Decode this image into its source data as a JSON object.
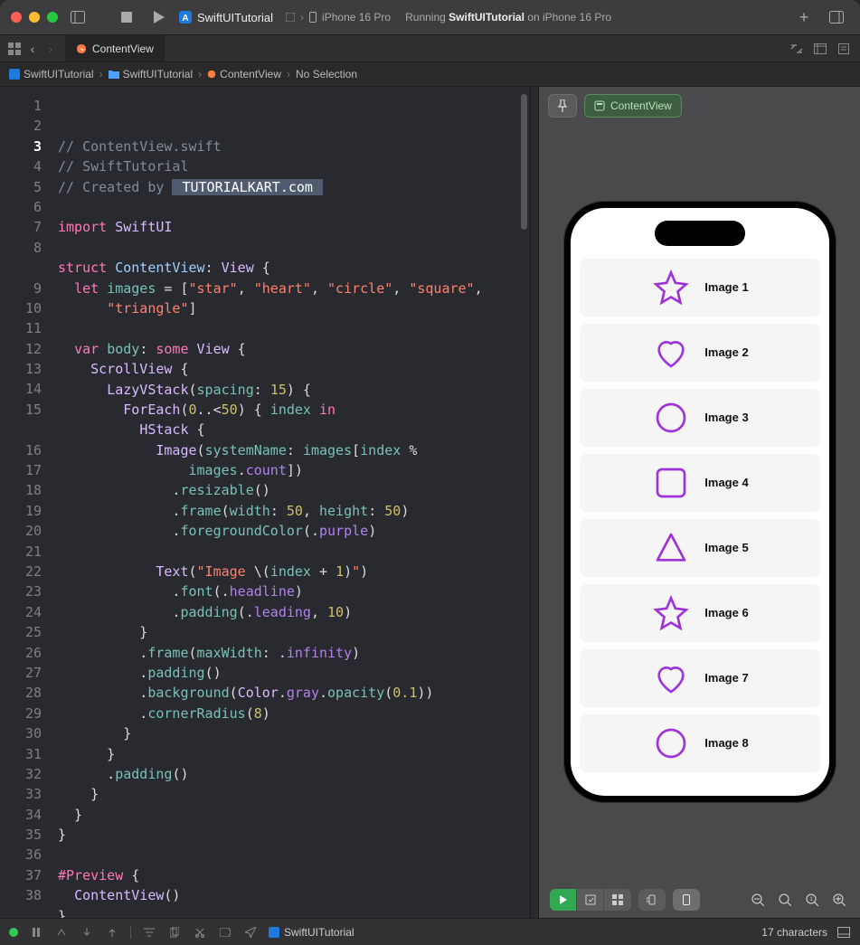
{
  "window": {
    "project_name": "SwiftUITutorial",
    "device": "iPhone 16 Pro",
    "status_prefix": "Running ",
    "status_bold": "SwiftUITutorial",
    "status_suffix": " on iPhone 16 Pro"
  },
  "tab": {
    "name": "ContentView"
  },
  "breadcrumb": {
    "items": [
      "SwiftUITutorial",
      "SwiftUITutorial",
      "ContentView",
      "No Selection"
    ]
  },
  "code": {
    "lines": [
      {
        "n": 1,
        "seg": [
          [
            "cm",
            "// ContentView.swift"
          ]
        ]
      },
      {
        "n": 2,
        "seg": [
          [
            "cm",
            "// SwiftTutorial"
          ]
        ]
      },
      {
        "n": 3,
        "seg": [
          [
            "cm",
            "// Created by "
          ],
          [
            "hlsel",
            " TUTORIALKART.com "
          ]
        ],
        "current": true
      },
      {
        "n": 4,
        "seg": []
      },
      {
        "n": 5,
        "seg": [
          [
            "kw",
            "import"
          ],
          [
            "pn",
            " "
          ],
          [
            "ty",
            "SwiftUI"
          ]
        ]
      },
      {
        "n": 6,
        "seg": []
      },
      {
        "n": 7,
        "seg": [
          [
            "kw",
            "struct"
          ],
          [
            "pn",
            " "
          ],
          [
            "id2",
            "ContentView"
          ],
          [
            "pn",
            ": "
          ],
          [
            "ty",
            "View"
          ],
          [
            "pn",
            " {"
          ]
        ]
      },
      {
        "n": 8,
        "seg": [
          [
            "pn",
            "  "
          ],
          [
            "kw",
            "let"
          ],
          [
            "pn",
            " "
          ],
          [
            "id",
            "images"
          ],
          [
            "pn",
            " = ["
          ],
          [
            "st",
            "\"star\""
          ],
          [
            "pn",
            ", "
          ],
          [
            "st",
            "\"heart\""
          ],
          [
            "pn",
            ", "
          ],
          [
            "st",
            "\"circle\""
          ],
          [
            "pn",
            ", "
          ],
          [
            "st",
            "\"square\""
          ],
          [
            "pn",
            ","
          ]
        ]
      },
      {
        "n": 0,
        "cont": true,
        "seg": [
          [
            "pn",
            "      "
          ],
          [
            "st",
            "\"triangle\""
          ],
          [
            "pn",
            "]"
          ]
        ]
      },
      {
        "n": 9,
        "seg": []
      },
      {
        "n": 10,
        "seg": [
          [
            "pn",
            "  "
          ],
          [
            "kw",
            "var"
          ],
          [
            "pn",
            " "
          ],
          [
            "id",
            "body"
          ],
          [
            "pn",
            ": "
          ],
          [
            "kw",
            "some"
          ],
          [
            "pn",
            " "
          ],
          [
            "ty",
            "View"
          ],
          [
            "pn",
            " {"
          ]
        ]
      },
      {
        "n": 11,
        "seg": [
          [
            "pn",
            "    "
          ],
          [
            "ty",
            "ScrollView"
          ],
          [
            "pn",
            " {"
          ]
        ]
      },
      {
        "n": 12,
        "seg": [
          [
            "pn",
            "      "
          ],
          [
            "ty",
            "LazyVStack"
          ],
          [
            "pn",
            "("
          ],
          [
            "fn",
            "spacing"
          ],
          [
            "pn",
            ": "
          ],
          [
            "nm",
            "15"
          ],
          [
            "pn",
            ") {"
          ]
        ]
      },
      {
        "n": 13,
        "seg": [
          [
            "pn",
            "        "
          ],
          [
            "ty",
            "ForEach"
          ],
          [
            "pn",
            "("
          ],
          [
            "nm",
            "0"
          ],
          [
            "pn",
            ".."
          ],
          [
            "pn",
            "<"
          ],
          [
            "nm",
            "50"
          ],
          [
            "pn",
            ") { "
          ],
          [
            "id",
            "index"
          ],
          [
            "pn",
            " "
          ],
          [
            "kw",
            "in"
          ]
        ]
      },
      {
        "n": 14,
        "seg": [
          [
            "pn",
            "          "
          ],
          [
            "ty",
            "HStack"
          ],
          [
            "pn",
            " {"
          ]
        ]
      },
      {
        "n": 15,
        "seg": [
          [
            "pn",
            "            "
          ],
          [
            "ty",
            "Image"
          ],
          [
            "pn",
            "("
          ],
          [
            "fn",
            "systemName"
          ],
          [
            "pn",
            ": "
          ],
          [
            "id",
            "images"
          ],
          [
            "pn",
            "["
          ],
          [
            "id",
            "index"
          ],
          [
            "pn",
            " %"
          ]
        ]
      },
      {
        "n": 0,
        "cont": true,
        "seg": [
          [
            "pn",
            "                "
          ],
          [
            "id",
            "images"
          ],
          [
            "pn",
            "."
          ],
          [
            "fn2",
            "count"
          ],
          [
            "pn",
            "])"
          ]
        ]
      },
      {
        "n": 16,
        "seg": [
          [
            "pn",
            "              ."
          ],
          [
            "fn",
            "resizable"
          ],
          [
            "pn",
            "()"
          ]
        ]
      },
      {
        "n": 17,
        "seg": [
          [
            "pn",
            "              ."
          ],
          [
            "fn",
            "frame"
          ],
          [
            "pn",
            "("
          ],
          [
            "fn",
            "width"
          ],
          [
            "pn",
            ": "
          ],
          [
            "nm",
            "50"
          ],
          [
            "pn",
            ", "
          ],
          [
            "fn",
            "height"
          ],
          [
            "pn",
            ": "
          ],
          [
            "nm",
            "50"
          ],
          [
            "pn",
            ")"
          ]
        ]
      },
      {
        "n": 18,
        "seg": [
          [
            "pn",
            "              ."
          ],
          [
            "fn",
            "foregroundColor"
          ],
          [
            "pn",
            "(."
          ],
          [
            "fn2",
            "purple"
          ],
          [
            "pn",
            ")"
          ]
        ]
      },
      {
        "n": 19,
        "seg": []
      },
      {
        "n": 20,
        "seg": [
          [
            "pn",
            "            "
          ],
          [
            "ty",
            "Text"
          ],
          [
            "pn",
            "("
          ],
          [
            "st",
            "\"Image "
          ],
          [
            "pn",
            "\\("
          ],
          [
            "id",
            "index"
          ],
          [
            "pn",
            " + "
          ],
          [
            "nm",
            "1"
          ],
          [
            "pn",
            ")"
          ],
          [
            "st",
            "\""
          ],
          [
            "pn",
            ")"
          ]
        ]
      },
      {
        "n": 21,
        "seg": [
          [
            "pn",
            "              ."
          ],
          [
            "fn",
            "font"
          ],
          [
            "pn",
            "(."
          ],
          [
            "fn2",
            "headline"
          ],
          [
            "pn",
            ")"
          ]
        ]
      },
      {
        "n": 22,
        "seg": [
          [
            "pn",
            "              ."
          ],
          [
            "fn",
            "padding"
          ],
          [
            "pn",
            "(."
          ],
          [
            "fn2",
            "leading"
          ],
          [
            "pn",
            ", "
          ],
          [
            "nm",
            "10"
          ],
          [
            "pn",
            ")"
          ]
        ]
      },
      {
        "n": 23,
        "seg": [
          [
            "pn",
            "          }"
          ]
        ]
      },
      {
        "n": 24,
        "seg": [
          [
            "pn",
            "          ."
          ],
          [
            "fn",
            "frame"
          ],
          [
            "pn",
            "("
          ],
          [
            "fn",
            "maxWidth"
          ],
          [
            "pn",
            ": ."
          ],
          [
            "fn2",
            "infinity"
          ],
          [
            "pn",
            ")"
          ]
        ]
      },
      {
        "n": 25,
        "seg": [
          [
            "pn",
            "          ."
          ],
          [
            "fn",
            "padding"
          ],
          [
            "pn",
            "()"
          ]
        ]
      },
      {
        "n": 26,
        "seg": [
          [
            "pn",
            "          ."
          ],
          [
            "fn",
            "background"
          ],
          [
            "pn",
            "("
          ],
          [
            "ty",
            "Color"
          ],
          [
            "pn",
            "."
          ],
          [
            "fn2",
            "gray"
          ],
          [
            "pn",
            "."
          ],
          [
            "fn",
            "opacity"
          ],
          [
            "pn",
            "("
          ],
          [
            "nm",
            "0.1"
          ],
          [
            "pn",
            "))"
          ]
        ]
      },
      {
        "n": 27,
        "seg": [
          [
            "pn",
            "          ."
          ],
          [
            "fn",
            "cornerRadius"
          ],
          [
            "pn",
            "("
          ],
          [
            "nm",
            "8"
          ],
          [
            "pn",
            ")"
          ]
        ]
      },
      {
        "n": 28,
        "seg": [
          [
            "pn",
            "        }"
          ]
        ]
      },
      {
        "n": 29,
        "seg": [
          [
            "pn",
            "      }"
          ]
        ]
      },
      {
        "n": 30,
        "seg": [
          [
            "pn",
            "      ."
          ],
          [
            "fn",
            "padding"
          ],
          [
            "pn",
            "()"
          ]
        ]
      },
      {
        "n": 31,
        "seg": [
          [
            "pn",
            "    }"
          ]
        ]
      },
      {
        "n": 32,
        "seg": [
          [
            "pn",
            "  }"
          ]
        ]
      },
      {
        "n": 33,
        "seg": [
          [
            "pn",
            "}"
          ]
        ]
      },
      {
        "n": 34,
        "seg": []
      },
      {
        "n": 35,
        "seg": [
          [
            "kw",
            "#Preview"
          ],
          [
            "pn",
            " {"
          ]
        ]
      },
      {
        "n": 36,
        "seg": [
          [
            "pn",
            "  "
          ],
          [
            "ty",
            "ContentView"
          ],
          [
            "pn",
            "()"
          ]
        ]
      },
      {
        "n": 37,
        "seg": [
          [
            "pn",
            "}"
          ]
        ]
      },
      {
        "n": 38,
        "seg": []
      }
    ]
  },
  "preview": {
    "badge": "ContentView",
    "rows": [
      {
        "label": "Image 1",
        "icon": "star"
      },
      {
        "label": "Image 2",
        "icon": "heart"
      },
      {
        "label": "Image 3",
        "icon": "circle"
      },
      {
        "label": "Image 4",
        "icon": "square"
      },
      {
        "label": "Image 5",
        "icon": "triangle"
      },
      {
        "label": "Image 6",
        "icon": "star"
      },
      {
        "label": "Image 7",
        "icon": "heart"
      },
      {
        "label": "Image 8",
        "icon": "circle"
      }
    ]
  },
  "statusbar": {
    "project": "SwiftUITutorial",
    "chars": "17 characters"
  }
}
